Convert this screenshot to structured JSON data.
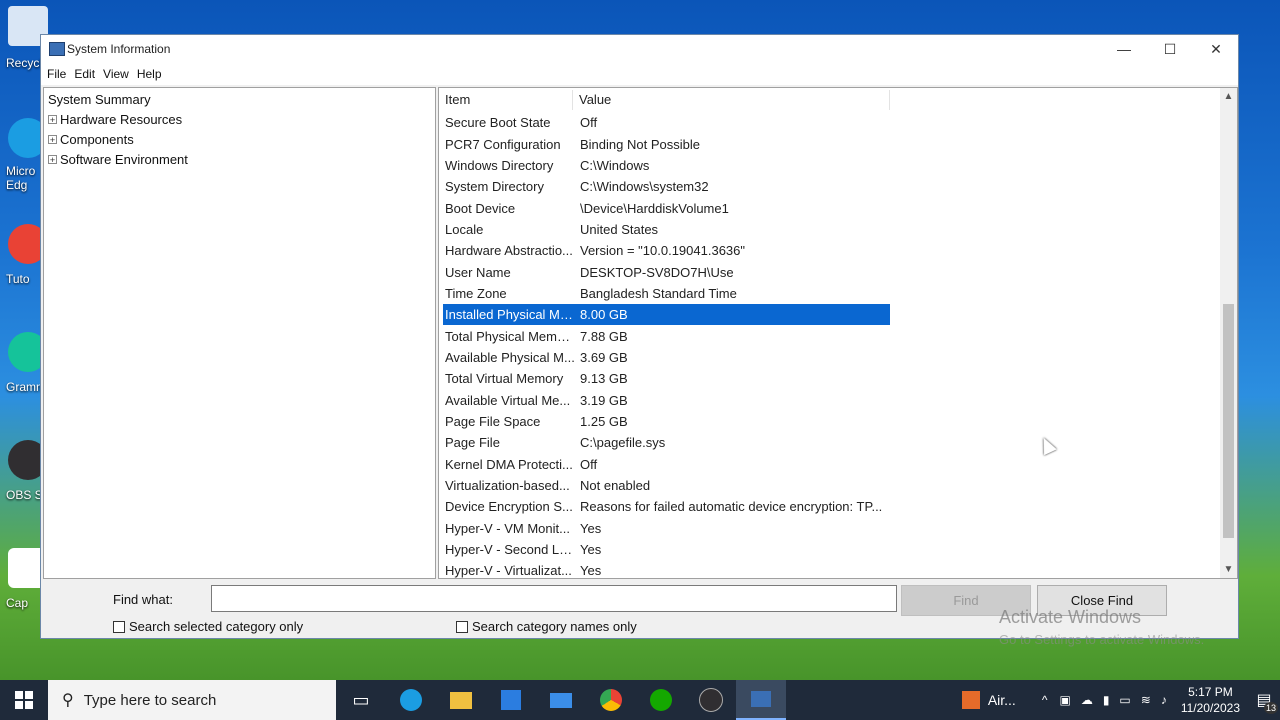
{
  "desktop": {
    "icons": [
      {
        "label": "Recycl",
        "color": "#d9e6f5"
      },
      {
        "label": "Micro Edg",
        "color": "#1b9de2"
      },
      {
        "label": "Tuto",
        "color": "#e94235"
      },
      {
        "label": "Gramm",
        "color": "#15c39a"
      },
      {
        "label": "OBS S",
        "color": "#302e31"
      },
      {
        "label": "Cap",
        "color": "#ffffff"
      }
    ]
  },
  "window": {
    "title": "System Information",
    "controls": {
      "minimize": "—",
      "maximize": "☐",
      "close": "✕"
    },
    "menu": [
      "File",
      "Edit",
      "View",
      "Help"
    ]
  },
  "tree": {
    "root": "System Summary",
    "children": [
      "Hardware Resources",
      "Components",
      "Software Environment"
    ],
    "expander_symbol": "+"
  },
  "list": {
    "headers": {
      "item": "Item",
      "value": "Value"
    },
    "rows": [
      {
        "item": "Secure Boot State",
        "value": "Off"
      },
      {
        "item": "PCR7 Configuration",
        "value": "Binding Not Possible"
      },
      {
        "item": "Windows Directory",
        "value": "C:\\Windows"
      },
      {
        "item": "System Directory",
        "value": "C:\\Windows\\system32"
      },
      {
        "item": "Boot Device",
        "value": "\\Device\\HarddiskVolume1"
      },
      {
        "item": "Locale",
        "value": "United States"
      },
      {
        "item": "Hardware Abstractio...",
        "value": "Version = \"10.0.19041.3636\""
      },
      {
        "item": "User Name",
        "value": "DESKTOP-SV8DO7H\\Use"
      },
      {
        "item": "Time Zone",
        "value": "Bangladesh Standard Time"
      },
      {
        "item": "Installed Physical Me...",
        "value": "8.00 GB",
        "selected": true
      },
      {
        "item": "Total Physical Memo...",
        "value": "7.88 GB"
      },
      {
        "item": "Available Physical M...",
        "value": "3.69 GB"
      },
      {
        "item": "Total Virtual Memory",
        "value": "9.13 GB"
      },
      {
        "item": "Available Virtual Me...",
        "value": "3.19 GB"
      },
      {
        "item": "Page File Space",
        "value": "1.25 GB"
      },
      {
        "item": "Page File",
        "value": "C:\\pagefile.sys"
      },
      {
        "item": "Kernel DMA Protecti...",
        "value": "Off"
      },
      {
        "item": "Virtualization-based...",
        "value": "Not enabled"
      },
      {
        "item": "Device Encryption S...",
        "value": "Reasons for failed automatic device encryption: TP..."
      },
      {
        "item": "Hyper-V - VM Monit...",
        "value": "Yes"
      },
      {
        "item": "Hyper-V - Second Le...",
        "value": "Yes"
      },
      {
        "item": "Hyper-V - Virtualizat...",
        "value": "Yes"
      }
    ]
  },
  "find": {
    "label": "Find what:",
    "value": "",
    "find_button": "Find",
    "close_button": "Close Find",
    "check_selected": "Search selected category only",
    "check_names": "Search category names only"
  },
  "watermark": {
    "title": "Activate Windows",
    "subtitle": "Go to Settings to activate Windows."
  },
  "taskbar": {
    "search_placeholder": "Type here to search",
    "weather": "Air...",
    "time": "5:17 PM",
    "date": "11/20/2023",
    "notifications": "13"
  },
  "colors": {
    "selection": "#0a67d1",
    "taskbar": "#1f2a3a"
  }
}
